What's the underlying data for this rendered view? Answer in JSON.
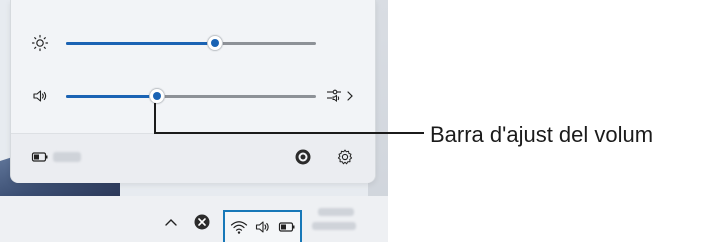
{
  "quick_settings": {
    "brightness": {
      "icon": "brightness-icon",
      "level": 0.63
    },
    "volume": {
      "icon": "speaker-icon",
      "level": 0.38,
      "output_icon": "audio-output-icon",
      "expand_icon": "chevron-right-icon"
    },
    "footer": {
      "battery_icon": "battery-icon",
      "edit_icon": "edit-icon",
      "settings_icon": "gear-icon"
    }
  },
  "taskbar": {
    "tray": {
      "overflow_icon": "chevron-up-icon",
      "app_icon": "app-close-icon",
      "wifi_icon": "wifi-icon",
      "speaker_icon": "speaker-icon",
      "battery_icon": "battery-icon"
    }
  },
  "callout": {
    "label": "Barra d'ajust del volum"
  },
  "colors": {
    "accent": "#1a63b4",
    "highlight_border": "#1778b8",
    "panel": "#f2f4f7"
  }
}
